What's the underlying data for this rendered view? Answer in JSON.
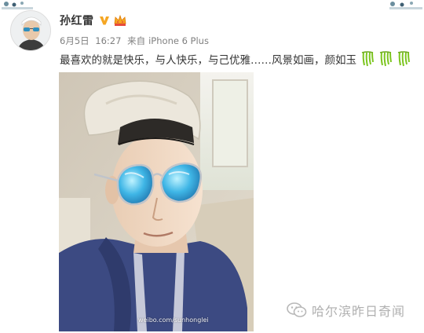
{
  "post": {
    "username": "孙红雷",
    "date": "6月5日",
    "time": "16:27",
    "source_prefix": "来自",
    "source_device": "iPhone 6 Plus",
    "text": "最喜欢的就是快乐，与人快乐，与己优雅……风景如画，颜如玉",
    "emoji_icons": [
      "willow-emoji",
      "willow-emoji",
      "willow-emoji"
    ],
    "photo_watermark": "weibo.com/sunhonglei"
  },
  "overlay": {
    "account_label": "哈尔滨昨日奇闻",
    "icon": "wechat-icon"
  },
  "colors": {
    "name": "#333333",
    "meta": "#808080",
    "vip": "#f5a623",
    "willow": "#7cc51f",
    "watermark": "#b0b0b0"
  }
}
